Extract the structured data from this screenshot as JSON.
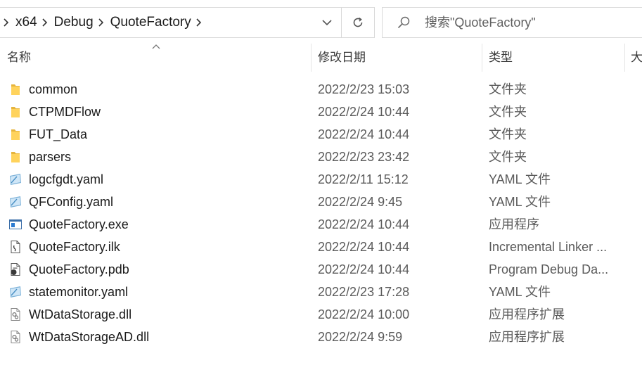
{
  "address": {
    "crumbs": [
      "x64",
      "Debug",
      "QuoteFactory"
    ]
  },
  "search": {
    "placeholder": "搜索\"QuoteFactory\""
  },
  "columns": {
    "name": "名称",
    "date": "修改日期",
    "type": "类型",
    "size": "大"
  },
  "files": [
    {
      "name": "common",
      "date": "2022/2/23 15:03",
      "type": "文件夹",
      "icon": "folder-icon"
    },
    {
      "name": "CTPMDFlow",
      "date": "2022/2/24 10:44",
      "type": "文件夹",
      "icon": "folder-icon"
    },
    {
      "name": "FUT_Data",
      "date": "2022/2/24 10:44",
      "type": "文件夹",
      "icon": "folder-icon"
    },
    {
      "name": "parsers",
      "date": "2022/2/23 23:42",
      "type": "文件夹",
      "icon": "folder-icon"
    },
    {
      "name": "logcfgdt.yaml",
      "date": "2022/2/11 15:12",
      "type": "YAML 文件",
      "icon": "yaml-file-icon"
    },
    {
      "name": "QFConfig.yaml",
      "date": "2022/2/24 9:45",
      "type": "YAML 文件",
      "icon": "yaml-file-icon"
    },
    {
      "name": "QuoteFactory.exe",
      "date": "2022/2/24 10:44",
      "type": "应用程序",
      "icon": "exe-file-icon"
    },
    {
      "name": "QuoteFactory.ilk",
      "date": "2022/2/24 10:44",
      "type": "Incremental Linker ...",
      "icon": "ilk-file-icon"
    },
    {
      "name": "QuoteFactory.pdb",
      "date": "2022/2/24 10:44",
      "type": "Program Debug Da...",
      "icon": "pdb-file-icon"
    },
    {
      "name": "statemonitor.yaml",
      "date": "2022/2/23 17:28",
      "type": "YAML 文件",
      "icon": "yaml-file-icon"
    },
    {
      "name": "WtDataStorage.dll",
      "date": "2022/2/24 10:00",
      "type": "应用程序扩展",
      "icon": "dll-file-icon"
    },
    {
      "name": "WtDataStorageAD.dll",
      "date": "2022/2/24 9:59",
      "type": "应用程序扩展",
      "icon": "dll-file-icon"
    }
  ]
}
